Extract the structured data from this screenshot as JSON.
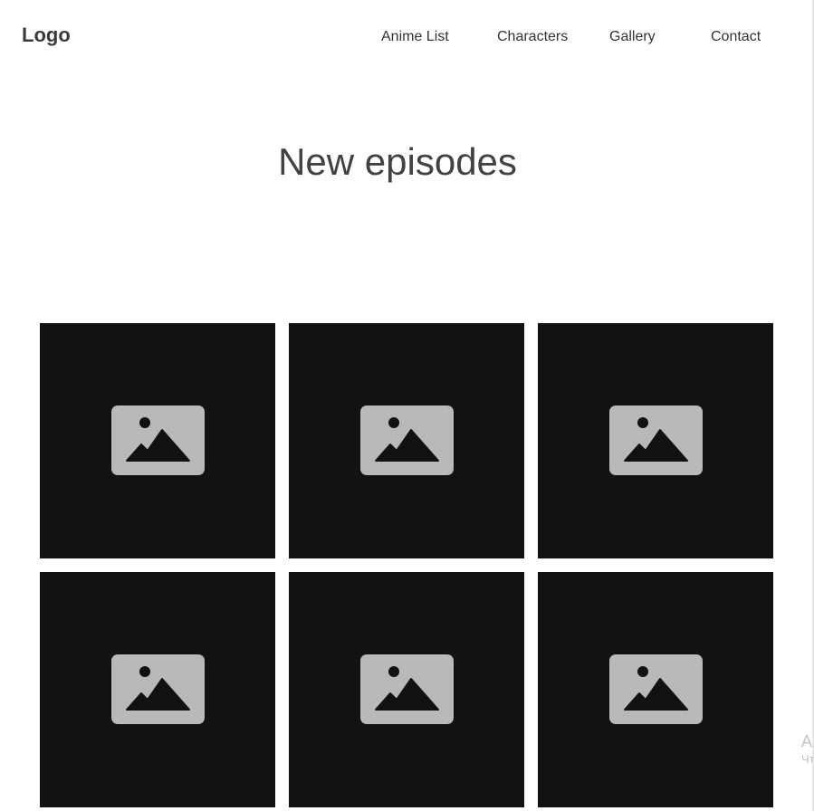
{
  "header": {
    "logo": "Logo",
    "nav": [
      "Anime List",
      "Characters",
      "Gallery",
      "Contact"
    ]
  },
  "main": {
    "title": "New episodes",
    "episodes": [
      {
        "icon": "image-placeholder-icon"
      },
      {
        "icon": "image-placeholder-icon"
      },
      {
        "icon": "image-placeholder-icon"
      },
      {
        "icon": "image-placeholder-icon"
      },
      {
        "icon": "image-placeholder-icon"
      },
      {
        "icon": "image-placeholder-icon"
      }
    ]
  },
  "corner": {
    "line1": "А",
    "line2": "Чт"
  },
  "colors": {
    "card_background": "#121212",
    "icon_frame": "#b9b9b9",
    "icon_glyph": "#111111",
    "text": "#444444"
  }
}
